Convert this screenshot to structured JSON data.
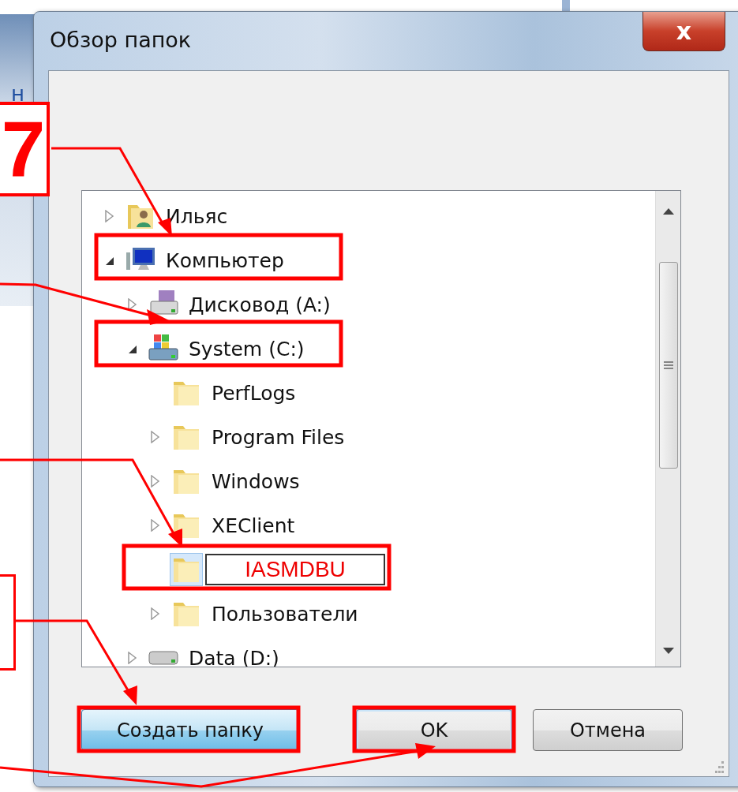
{
  "background_window": {
    "fragment": "н"
  },
  "dialog": {
    "title": "Обзор папок",
    "close": "x"
  },
  "tree": {
    "items": [
      {
        "label": "Ильяс",
        "kind": "user-folder",
        "expanded": false
      },
      {
        "label": "Компьютер",
        "kind": "computer",
        "expanded": true,
        "children": [
          {
            "label": "Дисковод (A:)",
            "kind": "floppy",
            "expanded": false
          },
          {
            "label": "System (C:)",
            "kind": "system-drive",
            "expanded": true,
            "children": [
              {
                "label": "PerfLogs",
                "kind": "folder"
              },
              {
                "label": "Program Files",
                "kind": "folder",
                "expanded": false
              },
              {
                "label": "Windows",
                "kind": "folder",
                "expanded": false
              },
              {
                "label": "XEClient",
                "kind": "folder",
                "expanded": false
              },
              {
                "label": "IASMDBU",
                "kind": "folder",
                "editing": true,
                "selected": true
              },
              {
                "label": "Пользователи",
                "kind": "folder",
                "expanded": false
              }
            ]
          },
          {
            "label": "Data (D:)",
            "kind": "drive",
            "expanded": false
          }
        ]
      }
    ]
  },
  "buttons": [
    {
      "label": "Создать папку",
      "kind": "normal",
      "focused": true
    },
    {
      "label": "OK",
      "kind": "default",
      "focused": false
    },
    {
      "label": "Отмена",
      "kind": "normal",
      "focused": false
    }
  ],
  "annotations": {
    "step_label": "7"
  }
}
